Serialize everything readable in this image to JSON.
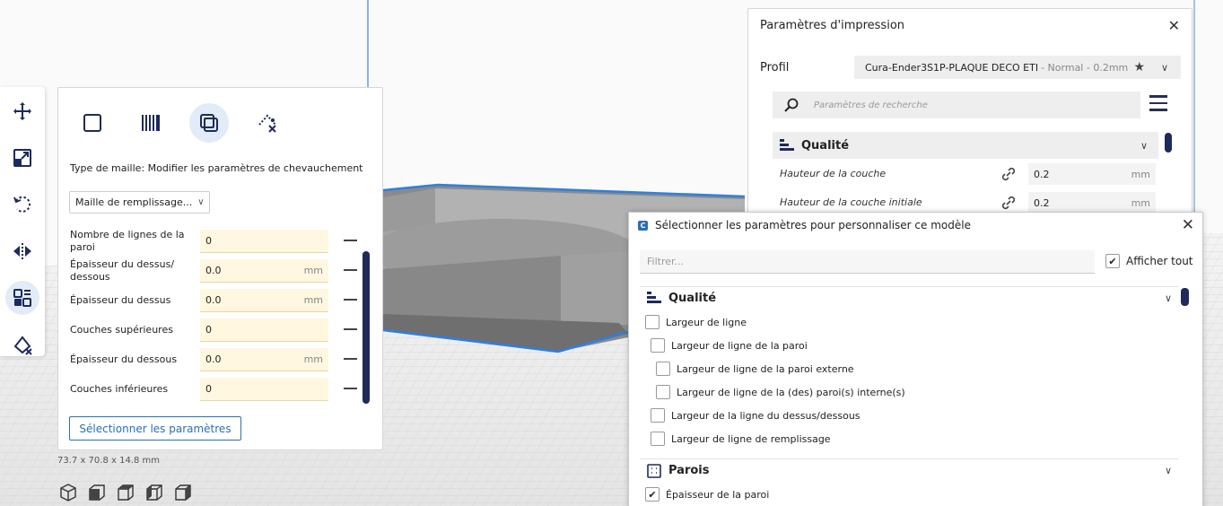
{
  "toolbar": {
    "tools": [
      {
        "name": "move-tool",
        "icon": "move-icon"
      },
      {
        "name": "scale-tool",
        "icon": "scale-icon"
      },
      {
        "name": "rotate-tool",
        "icon": "rotate-icon"
      },
      {
        "name": "mirror-tool",
        "icon": "mirror-icon"
      },
      {
        "name": "per-model-settings-tool",
        "icon": "per-model-settings-icon",
        "active": true
      },
      {
        "name": "support-blocker-tool",
        "icon": "support-blocker-icon"
      }
    ]
  },
  "per_model": {
    "mesh_types": [
      "normal-model-icon",
      "infill-mesh-icon",
      "overlap-mesh-icon",
      "support-mesh-icon"
    ],
    "active_mesh_type": 2,
    "description": "Type de maille: Modifier les paramètres de chevauchement",
    "dropdown_value": "Maille de remplissage...",
    "settings": [
      {
        "label": "Nombre de lignes de la paroi",
        "value": "0",
        "unit": ""
      },
      {
        "label": "Épaisseur du dessus/ dessous",
        "value": "0.0",
        "unit": "mm"
      },
      {
        "label": "Épaisseur du dessus",
        "value": "0.0",
        "unit": "mm"
      },
      {
        "label": "Couches supérieures",
        "value": "0",
        "unit": ""
      },
      {
        "label": "Épaisseur du dessous",
        "value": "0.0",
        "unit": "mm"
      },
      {
        "label": "Couches inférieures",
        "value": "0",
        "unit": ""
      }
    ],
    "select_button": "Sélectionner les paramètres"
  },
  "model_dimensions": "73.7 x 70.8 x 14.8 mm",
  "view_buttons": [
    "3d-view-icon",
    "front-view-icon",
    "top-view-icon",
    "left-view-icon",
    "right-view-icon"
  ],
  "print_settings": {
    "title": "Paramètres d'impression",
    "profile_label": "Profil",
    "profile_name": "Cura-Ender3S1P-PLAQUE DECO ETI",
    "profile_sub": "- Normal - 0.2mm",
    "search_placeholder": "Paramètres de recherche",
    "category": "Qualité",
    "settings": [
      {
        "label": "Hauteur de la couche",
        "value": "0.2",
        "unit": "mm"
      },
      {
        "label": "Hauteur de la couche initiale",
        "value": "0.2",
        "unit": "mm"
      }
    ]
  },
  "dialog": {
    "title": "Sélectionner les paramètres pour personnaliser ce modèle",
    "filter_placeholder": "Filtrer...",
    "show_all_label": "Afficher tout",
    "show_all_checked": true,
    "categories": [
      {
        "label": "Qualité",
        "items": [
          {
            "label": "Largeur de ligne",
            "level": 0,
            "checked": false
          },
          {
            "label": "Largeur de ligne de la paroi",
            "level": 1,
            "checked": false
          },
          {
            "label": "Largeur de ligne de la paroi externe",
            "level": 2,
            "checked": false
          },
          {
            "label": "Largeur de ligne de la (des) paroi(s) interne(s)",
            "level": 2,
            "checked": false
          },
          {
            "label": "Largeur de la ligne du dessus/dessous",
            "level": 1,
            "checked": false
          },
          {
            "label": "Largeur de ligne de remplissage",
            "level": 1,
            "checked": false
          }
        ]
      },
      {
        "label": "Parois",
        "items": [
          {
            "label": "Épaisseur de la paroi",
            "level": 0,
            "checked": true
          }
        ]
      }
    ]
  },
  "colors": {
    "accent": "#2b6fb6",
    "scrollbar": "#1e2a5a",
    "input_highlight": "#fff7e0",
    "model_outline": "#2f7fe0"
  }
}
